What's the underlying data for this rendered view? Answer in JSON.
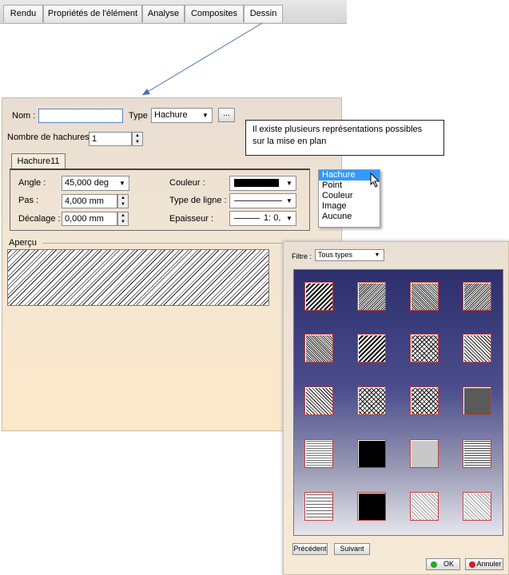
{
  "tabs": [
    "Rendu",
    "Propriétés de l'élément",
    "Analyse",
    "Composites",
    "Dessin"
  ],
  "dialog": {
    "nom_label": "Nom :",
    "nom_value": "",
    "type_label": "Type :",
    "type_value": "Hachure",
    "browse_label": "...",
    "nb_hachures_label": "Nombre de hachures :",
    "nb_hachures_value": "1",
    "hatch_tab": "Hachure11",
    "angle_label": "Angle :",
    "angle_value": "45,000 deg",
    "pas_label": "Pas :",
    "pas_value": "4,000 mm",
    "decalage_label": "Décalage :",
    "decalage_value": "0,000 mm",
    "couleur_label": "Couleur :",
    "type_ligne_label": "Type de ligne :",
    "epaisseur_label": "Epaisseur :",
    "epaisseur_value": "1: 0,",
    "apercu_label": "Aperçu"
  },
  "callout": {
    "line1": "Il existe plusieurs représentations possibles",
    "line2": "sur la mise en plan"
  },
  "type_options": [
    "Hachure",
    "Point",
    "Couleur",
    "Image",
    "Aucune"
  ],
  "chooser": {
    "filtre_label": "Filtre :",
    "filtre_value": "Tous types",
    "prev_label": "Précédent",
    "next_label": "Suivant",
    "ok_label": "OK",
    "cancel_label": "Annuler"
  },
  "colors": {
    "selection": "#3399ff",
    "ok_icon": "#2aa52a",
    "cancel_icon": "#d02020"
  }
}
